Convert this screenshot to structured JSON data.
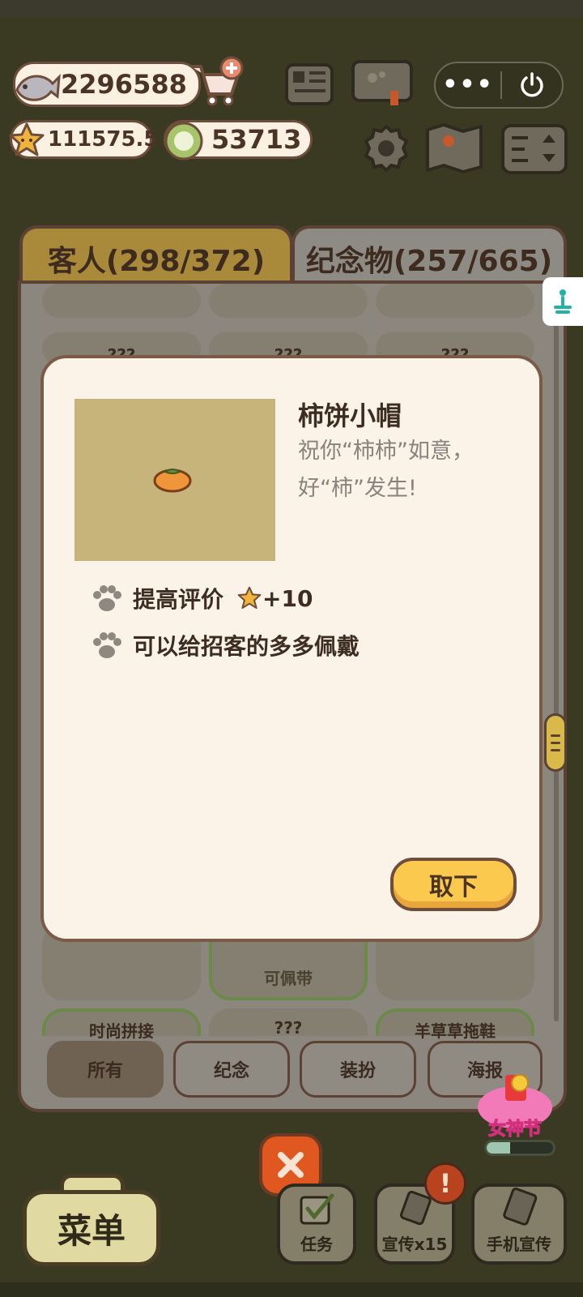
{
  "hud": {
    "fish": "2296588",
    "stars": "111575.5",
    "coins": "53713",
    "capsule_more": "•••"
  },
  "tabs": {
    "guests": "客人(298/372)",
    "souvenirs": "纪念物(257/665)"
  },
  "grid": {
    "unknown": "???",
    "wearable": "可佩带",
    "fashion": "时尚拼接",
    "bottom_right": "羊草草拖鞋"
  },
  "filters": [
    "所有",
    "纪念",
    "装扮",
    "海报"
  ],
  "dialog": {
    "title": "柿饼小帽",
    "desc_line1": "祝你“柿柿”如意，",
    "desc_line2": "好“柿”发生!",
    "feature1": "提高评价",
    "feature1_bonus": "+10",
    "feature2": "可以给招客的多多佩戴",
    "remove_button": "取下"
  },
  "bottom": {
    "menu": "菜单",
    "tasks": "任务",
    "promote": "宣传x15",
    "phone_promote": "手机宣传",
    "badge": "!"
  },
  "event": {
    "label": "女神节",
    "progress": 0.35
  },
  "colors": {
    "accent_yellow": "#fbc94d",
    "brown_border": "#6f4d3b",
    "close_orange": "#e0571f"
  }
}
